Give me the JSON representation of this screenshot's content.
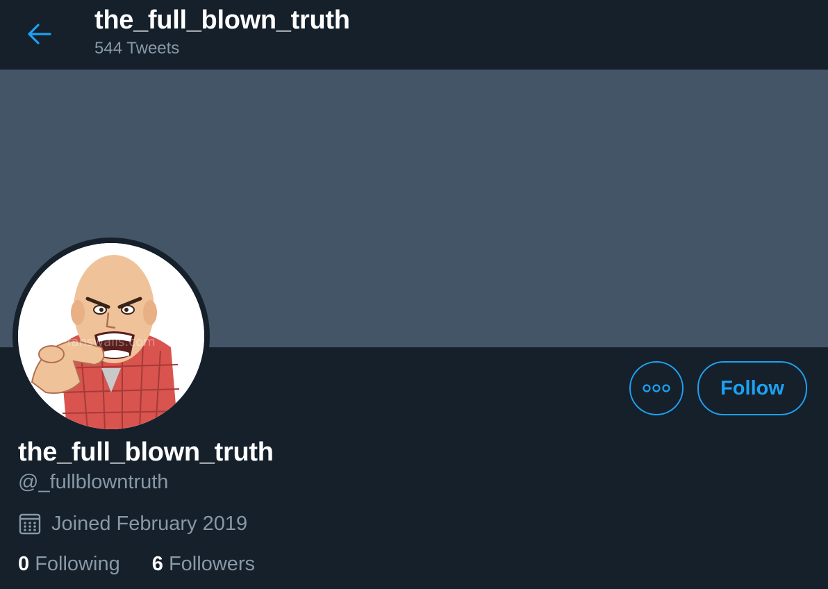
{
  "header": {
    "title": "the_full_blown_truth",
    "tweet_count": "544 Tweets",
    "back_icon": "arrow-left-icon"
  },
  "profile": {
    "display_name": "the_full_blown_truth",
    "handle": "@_fullblowntruth",
    "joined": "Joined February 2019",
    "avatar": "angry-bald-man-pointing-cartoon",
    "avatar_watermark": "fanswalls.com",
    "following_count": "0",
    "following_label": "Following",
    "followers_count": "6",
    "followers_label": "Followers"
  },
  "actions": {
    "more_icon": "more-options-icon",
    "follow_label": "Follow"
  },
  "colors": {
    "background": "#15202b",
    "banner": "#445567",
    "accent": "#1da1f2",
    "secondary_text": "#8899a6",
    "primary_text": "#ffffff"
  }
}
